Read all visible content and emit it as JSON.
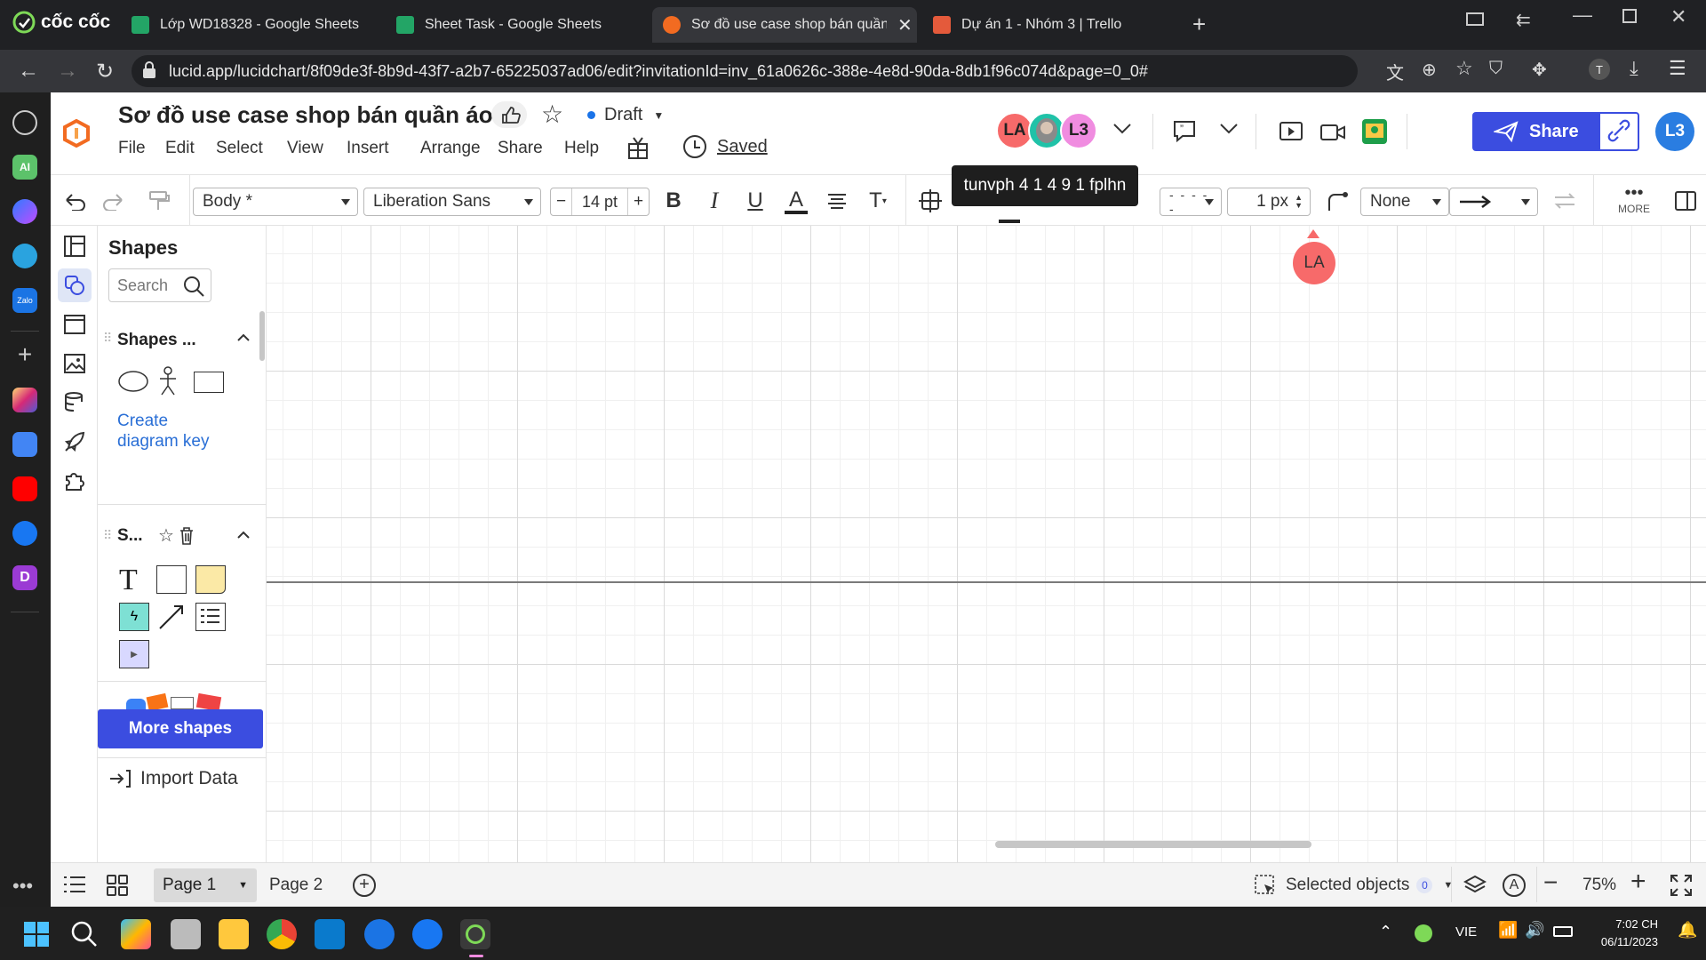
{
  "browser": {
    "brand": "cốc cốc",
    "tabs": [
      {
        "title": "Lớp WD18328 - Google Sheets",
        "color": "#23a566"
      },
      {
        "title": "Sheet Task - Google Sheets",
        "color": "#23a566"
      },
      {
        "title": "Sơ đồ use case shop bán quần á",
        "color": "#f26b21"
      },
      {
        "title": "Dự án 1 - Nhóm 3 | Trello",
        "color": "#e45a3b"
      }
    ],
    "new_tab": "+",
    "url": "lucid.app/lucidchart/8f09de3f-8b9d-43f7-a2b7-65225037ad06/edit?invitationId=inv_61a0626c-388e-4e8d-90da-8db1f96c074d&page=0_0#",
    "profile_initial": "T"
  },
  "doc": {
    "title": "Sơ đồ use case shop bán quần áo",
    "status": "Draft",
    "saved": "Saved",
    "menu": [
      "File",
      "Edit",
      "Select",
      "View",
      "Insert",
      "Arrange",
      "Share",
      "Help"
    ]
  },
  "collab": {
    "avatars": [
      {
        "initials": "LA",
        "color": "#f76a6a"
      },
      {
        "initials": "",
        "color": "#20c2a8"
      },
      {
        "initials": "L3",
        "color": "#f08ce0"
      }
    ],
    "tooltip": "tunvph 4 1 4 9 1 fplhn",
    "me": "L3",
    "share_label": "Share"
  },
  "toolbar": {
    "text_style": "Body *",
    "font": "Liberation Sans",
    "size": "14 pt",
    "minus": "−",
    "plus": "+",
    "bold": "B",
    "italic": "I",
    "underline": "U",
    "text_color": "A",
    "line_width": "1 px",
    "endpoint": "None",
    "more": "MORE"
  },
  "panel": {
    "title": "Shapes",
    "search_placeholder": "Search",
    "section1": "Shapes ...",
    "create_key": "Create diagram key",
    "section2": "S...",
    "more_shapes": "More shapes",
    "import": "Import Data"
  },
  "canvas": {
    "cursor_label": "LA",
    "cursor_color": "#f76a6a"
  },
  "bottom": {
    "pages": [
      "Page 1",
      "Page 2"
    ],
    "selected_objects": "Selected objects",
    "selected_count": "0",
    "zoom": "75%"
  },
  "taskbar": {
    "lang": "VIE",
    "time": "7:02 CH",
    "date": "06/11/2023"
  }
}
